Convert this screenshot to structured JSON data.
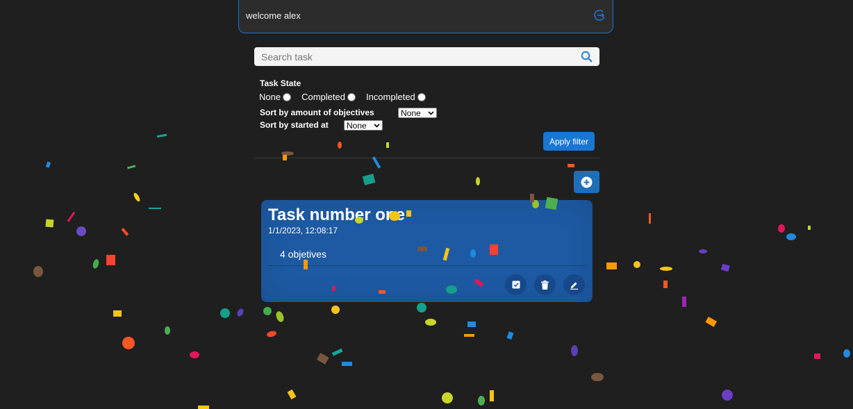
{
  "header": {
    "welcome_text": "welcome alex",
    "logout_icon": "logout-icon"
  },
  "search": {
    "placeholder": "Search task",
    "value": "",
    "icon": "search-icon"
  },
  "filters": {
    "title": "Task State",
    "state_options": [
      {
        "label": "None",
        "selected": false
      },
      {
        "label": "Completed",
        "selected": false
      },
      {
        "label": "Incompleted",
        "selected": false
      }
    ],
    "sort_objectives_label": "Sort by amount of objectives",
    "sort_objectives_value": "None",
    "sort_started_label": "Sort by started at",
    "sort_started_value": "None",
    "apply_label": "Apply filter"
  },
  "actions": {
    "add_icon": "plus-circle-icon"
  },
  "tasks": [
    {
      "title": "Task number one",
      "date": "1/1/2023, 12:08:17",
      "objectives": "4 objetives",
      "icons": [
        "checkbox-icon",
        "trash-icon",
        "pencil-icon"
      ]
    }
  ],
  "colors": {
    "background": "#1f1f1f",
    "accent": "#1976d2",
    "card": "#1d5aa3"
  }
}
